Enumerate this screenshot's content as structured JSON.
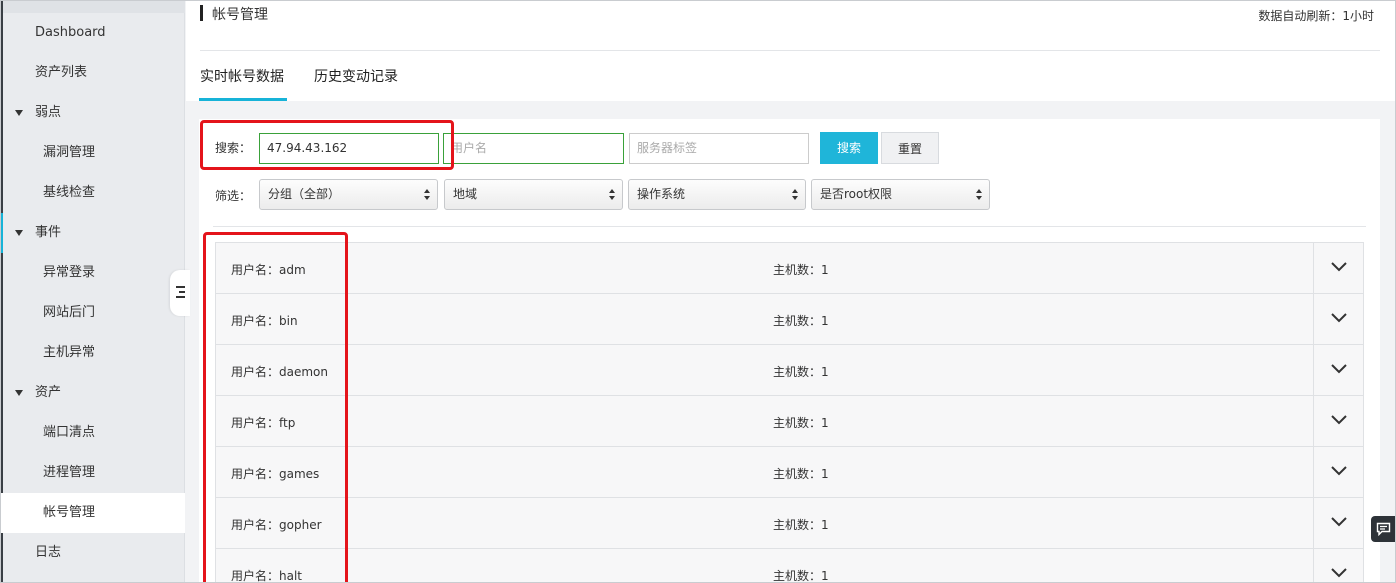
{
  "sidebar": {
    "items": [
      {
        "label": "Dashboard",
        "kind": "top"
      },
      {
        "label": "资产列表",
        "kind": "top"
      },
      {
        "label": "弱点",
        "kind": "group"
      },
      {
        "label": "漏洞管理",
        "kind": "sub"
      },
      {
        "label": "基线检查",
        "kind": "sub"
      },
      {
        "label": "事件",
        "kind": "group"
      },
      {
        "label": "异常登录",
        "kind": "sub"
      },
      {
        "label": "网站后门",
        "kind": "sub"
      },
      {
        "label": "主机异常",
        "kind": "sub"
      },
      {
        "label": "资产",
        "kind": "group"
      },
      {
        "label": "端口清点",
        "kind": "sub"
      },
      {
        "label": "进程管理",
        "kind": "sub"
      },
      {
        "label": "帐号管理",
        "kind": "sub",
        "active": true
      },
      {
        "label": "日志",
        "kind": "top"
      }
    ]
  },
  "header": {
    "title": "帐号管理",
    "refresh": "数据自动刷新：1小时",
    "tabs": [
      {
        "label": "实时帐号数据",
        "active": true
      },
      {
        "label": "历史变动记录",
        "active": false
      }
    ]
  },
  "search": {
    "label": "搜索：",
    "ip_value": "47.94.43.162",
    "username_placeholder": "用户名",
    "tag_placeholder": "服务器标签",
    "search_button": "搜索",
    "reset_button": "重置"
  },
  "filter": {
    "label": "筛选：",
    "group": "分组（全部）",
    "region": "地域",
    "os": "操作系统",
    "root": "是否root权限"
  },
  "accounts": {
    "user_prefix": "用户名：",
    "hosts_prefix": "主机数：",
    "rows": [
      {
        "username": "adm",
        "hosts": "1"
      },
      {
        "username": "bin",
        "hosts": "1"
      },
      {
        "username": "daemon",
        "hosts": "1"
      },
      {
        "username": "ftp",
        "hosts": "1"
      },
      {
        "username": "games",
        "hosts": "1"
      },
      {
        "username": "gopher",
        "hosts": "1"
      },
      {
        "username": "halt",
        "hosts": "1"
      }
    ]
  },
  "colors": {
    "accent": "#1fb5d9",
    "highlight": "#e4141b",
    "focus_border": "#3aa13a"
  }
}
